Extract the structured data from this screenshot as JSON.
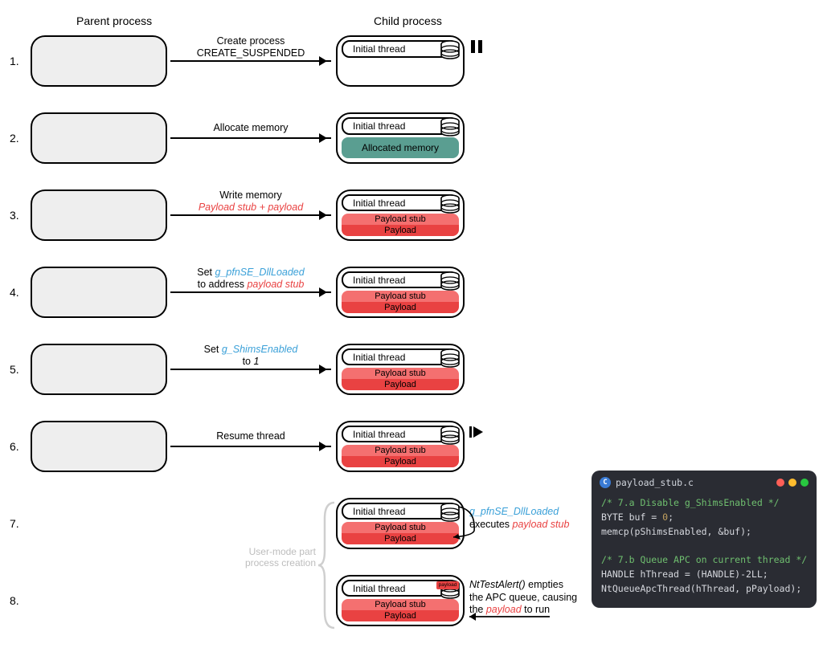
{
  "headers": {
    "parent": "Parent process",
    "child": "Child process"
  },
  "steps": [
    {
      "num": "1.",
      "arrow_line1": "Create process",
      "arrow_line2": "CREATE_SUSPENDED",
      "thread": "Initial thread",
      "extra": "pause"
    },
    {
      "num": "2.",
      "arrow_line1": "Allocate memory",
      "arrow_line2": "",
      "thread": "Initial thread",
      "mem_label": "Allocated memory",
      "mem_kind": "teal"
    },
    {
      "num": "3.",
      "arrow_line1": "Write memory",
      "arrow_line2_html": "payload_split",
      "stub_prefix": "Payload stub",
      "plus": " + ",
      "payload": "payload",
      "thread": "Initial thread",
      "mem_kind": "split",
      "mem_top": "Payload stub",
      "mem_bot": "Payload"
    },
    {
      "num": "4.",
      "arrow_line1_html": "set_dllloaded",
      "set_text": "Set ",
      "var": "g_pfnSE_DllLoaded",
      "arrow_line2_html": "to_addr",
      "to_text": "to address ",
      "stub": "payload stub",
      "thread": "Initial thread",
      "mem_kind": "split",
      "mem_top": "Payload stub",
      "mem_bot": "Payload"
    },
    {
      "num": "5.",
      "arrow_line1_html": "set_shims",
      "set_text": "Set ",
      "var": "g_ShimsEnabled",
      "arrow_line2_html": "to_one",
      "to_text": "to ",
      "one": "1",
      "thread": "Initial thread",
      "mem_kind": "split",
      "mem_top": "Payload stub",
      "mem_bot": "Payload"
    },
    {
      "num": "6.",
      "arrow_line1": "Resume thread",
      "arrow_line2": "",
      "thread": "Initial thread",
      "mem_kind": "split",
      "mem_top": "Payload stub",
      "mem_bot": "Payload",
      "extra": "play"
    },
    {
      "num": "7.",
      "no_parent": true,
      "thread": "Initial thread",
      "mem_kind": "split",
      "mem_top": "Payload stub",
      "mem_bot": "Payload"
    },
    {
      "num": "8.",
      "no_parent": true,
      "thread": "Initial thread",
      "mem_kind": "split",
      "mem_top": "Payload stub",
      "mem_bot": "Payload",
      "extra": "mini-payload",
      "mini_label": "payload"
    }
  ],
  "brace_label_line1": "User-mode part",
  "brace_label_line2": "process creation",
  "side7": {
    "var": "g_pfnSE_DllLoaded",
    "exec": "executes ",
    "stub": "payload stub"
  },
  "side8": {
    "fn": "NtTestAlert()",
    "rest1": " empties",
    "rest2": "the APC queue, causing",
    "rest3": "the ",
    "payload": "payload",
    "rest4": " to run"
  },
  "code": {
    "filename": "payload_stub.c",
    "comment_a": "/* 7.a Disable g_ShimsEnabled */",
    "line_a1_pre": "BYTE buf = ",
    "line_a1_val": "0",
    "line_a1_post": ";",
    "line_a2": "memcp(pShimsEnabled, &buf);",
    "comment_b": "/* 7.b Queue APC on current thread */",
    "line_b1": "HANDLE hThread = (HANDLE)-2LL;",
    "line_b2": "NtQueueApcThread(hThread, pPayload);"
  }
}
